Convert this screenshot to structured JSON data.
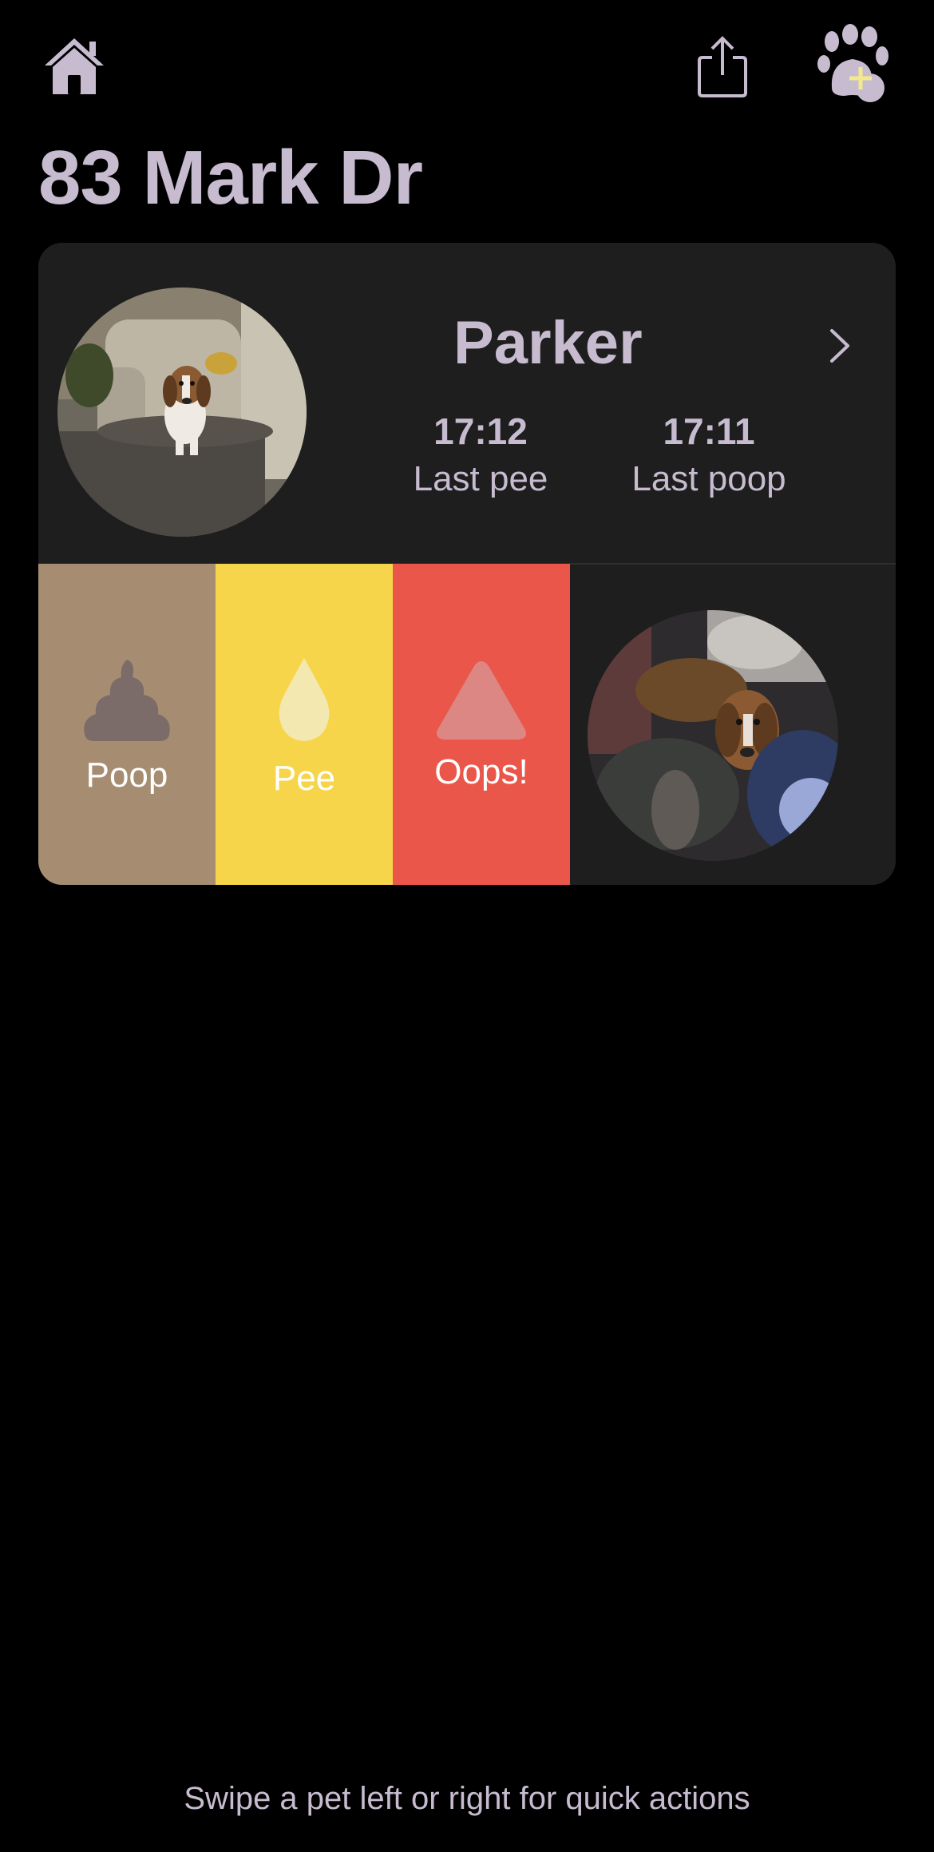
{
  "header": {
    "title": "83 Mark Dr",
    "home_icon": "home-icon",
    "share_icon": "share-icon",
    "add_pet_icon": "paw-plus-icon"
  },
  "pet": {
    "name": "Parker",
    "last_pee_time": "17:12",
    "last_pee_label": "Last pee",
    "last_poop_time": "17:11",
    "last_poop_label": "Last poop"
  },
  "actions": [
    {
      "label": "Poop",
      "icon": "poop-icon",
      "color": "#a68d72"
    },
    {
      "label": "Pee",
      "icon": "droplet-icon",
      "color": "#f7d54b"
    },
    {
      "label": "Oops!",
      "icon": "warning-triangle-icon",
      "color": "#ea574a"
    }
  ],
  "footer": {
    "hint": "Swipe a pet left or right for quick actions"
  },
  "colors": {
    "accent": "#c7bccf",
    "card_bg": "#1e1e1f",
    "background": "#000000"
  }
}
